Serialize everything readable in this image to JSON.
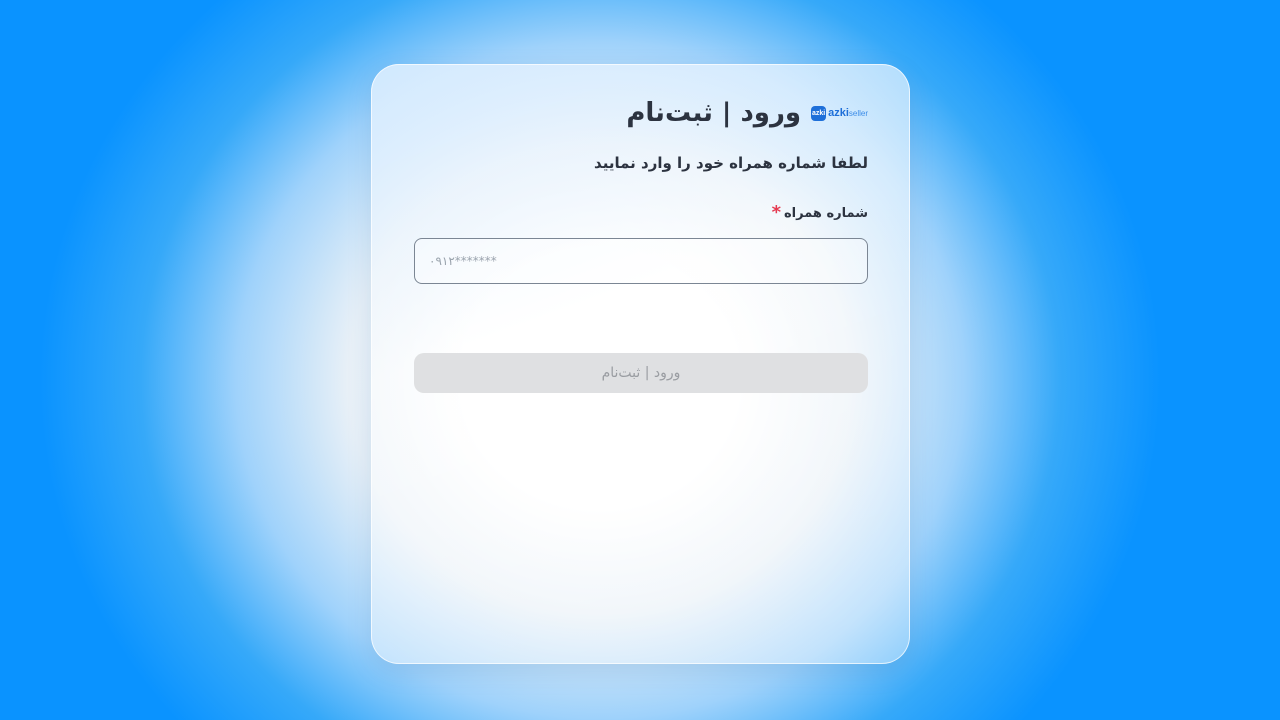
{
  "brand": {
    "logo_badge": "azki",
    "logo_main": "azki",
    "logo_sub": "seller"
  },
  "header": {
    "title": "ورود | ثبت‌نام"
  },
  "form": {
    "subtitle": "لطفا شماره همراه خود را وارد نمایید",
    "phone_label": "شماره همراه",
    "required_mark": "*",
    "phone_value": "",
    "phone_placeholder": "۰۹۱۲*******",
    "submit_label": "ورود | ثبت‌نام",
    "submit_enabled": false
  },
  "colors": {
    "accent": "#1e6fd9",
    "required": "#e53950",
    "text": "#2c3340",
    "disabled_bg": "#dfe0e2",
    "disabled_text": "#9a9da2"
  }
}
